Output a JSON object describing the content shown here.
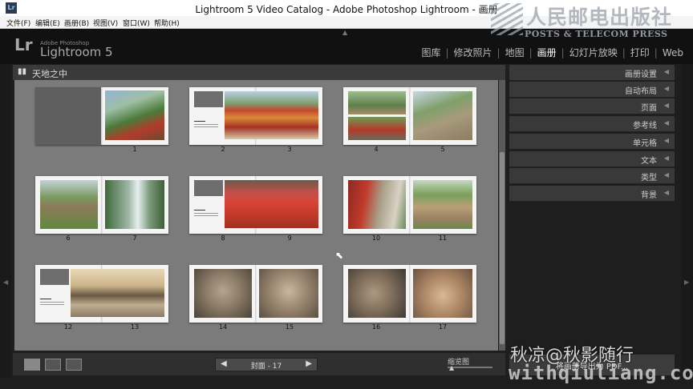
{
  "window": {
    "title": "Lightroom 5 Video Catalog - Adobe Photoshop Lightroom - 画册",
    "icon": "Lr"
  },
  "menu": [
    "文件(F)",
    "编辑(E)",
    "画册(B)",
    "视图(V)",
    "窗口(W)",
    "帮助(H)"
  ],
  "identity_plate": {
    "logo": "Lr",
    "small": "Adobe Photoshop",
    "name": "Lightroom 5"
  },
  "modules": [
    "图库",
    "修改照片",
    "地图",
    "画册",
    "幻灯片放映",
    "打印",
    "Web"
  ],
  "active_module": "画册",
  "book_title": "天地之中",
  "page_numbers": [
    "1",
    "2",
    "3",
    "4",
    "5",
    "6",
    "7",
    "8",
    "9",
    "10",
    "11",
    "12",
    "13",
    "14",
    "15",
    "16",
    "17"
  ],
  "right_panels": [
    "画册设置",
    "自动布局",
    "页面",
    "参考线",
    "单元格",
    "文本",
    "类型",
    "背景"
  ],
  "pager_label": "封面 - 17",
  "zoom_label": "缩览图",
  "export_label": "将画册导出为 PDF...",
  "watermark": {
    "cn": "人民邮电出版社",
    "en": "POSTS & TELECOM PRESS",
    "credit": "秋凉@秋影随行",
    "url": "withqiuliang.com"
  },
  "colors": {
    "canvas": "#7b7b7b",
    "panel": "#393939",
    "accent_red": "#c0392b"
  },
  "icons": [
    "grid-view-icon",
    "spread-view-icon",
    "single-view-icon",
    "prev-page-icon",
    "next-page-icon",
    "panel-collapse-icon",
    "filmstrip-icon"
  ]
}
